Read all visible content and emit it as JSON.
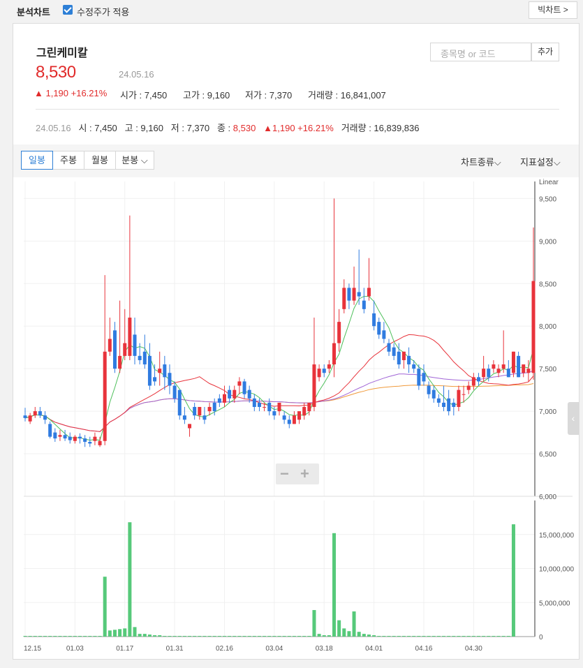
{
  "topbar": {
    "title": "분석차트",
    "adjusted_label": "수정주가 적용",
    "adjusted_checked": true,
    "big_chart": "빅차트 >"
  },
  "stock": {
    "name": "그린케미칼",
    "price": "8,530",
    "date": "24.05.16",
    "change": "▲ 1,190 +16.21%",
    "open_label": "시가 : 7,450",
    "high_label": "고가 : 9,160",
    "low_label": "저가 : 7,370",
    "volume_label": "거래량 : 16,841,007"
  },
  "search": {
    "placeholder": "종목명 or 코드",
    "add_label": "추가"
  },
  "detail": {
    "date": "24.05.16",
    "open": "시 : 7,450",
    "high": "고 : 9,160",
    "low": "저 : 7,370",
    "close_label": "종 :",
    "close": "8,530",
    "change": "▲1,190 +16.21%",
    "volume": "거래량 : 16,839,836"
  },
  "toolbar": {
    "periods": [
      "일봉",
      "주봉",
      "월봉",
      "분봉"
    ],
    "active_period": "일봉",
    "chart_type": "차트종류",
    "indicator": "지표설정"
  },
  "colors": {
    "up": "#e8333b",
    "down": "#2f7be0",
    "volume": "#56c97a",
    "ma5": "#4cbf5a",
    "ma20": "#e8333b",
    "ma60": "#a064d6",
    "ma120": "#f09a3b"
  },
  "chart_data": {
    "type": "candlestick",
    "scale": "Linear",
    "price_axis": {
      "ticks": [
        6000,
        6500,
        7000,
        7500,
        8000,
        8500,
        9000,
        9500
      ],
      "tick_labels": [
        "6,000",
        "6,500",
        "7,000",
        "7,500",
        "8,000",
        "8,500",
        "9,000",
        "9,500"
      ],
      "range": [
        6000,
        9700
      ]
    },
    "volume_axis": {
      "ticks": [
        0,
        5000000,
        10000000,
        15000000
      ],
      "tick_labels": [
        "0",
        "5,000,000",
        "10,000,000",
        "15,000,000"
      ],
      "range": [
        0,
        20000000
      ]
    },
    "x_labels": [
      {
        "label": "12.15",
        "index": 0
      },
      {
        "label": "01.03",
        "index": 10
      },
      {
        "label": "01.17",
        "index": 20
      },
      {
        "label": "01.31",
        "index": 30
      },
      {
        "label": "02.16",
        "index": 40
      },
      {
        "label": "03.04",
        "index": 50
      },
      {
        "label": "03.18",
        "index": 60
      },
      {
        "label": "04.01",
        "index": 70
      },
      {
        "label": "04.16",
        "index": 80
      },
      {
        "label": "04.30",
        "index": 90
      }
    ],
    "candles": [
      [
        6950,
        7040,
        6920,
        6880
      ],
      [
        6880,
        6980,
        6950,
        6850
      ],
      [
        6950,
        7050,
        7000,
        6920
      ],
      [
        7000,
        7050,
        6950,
        6920
      ],
      [
        6950,
        7000,
        6900,
        6850
      ],
      [
        6850,
        6880,
        6700,
        6680
      ],
      [
        6750,
        6800,
        6680,
        6640
      ],
      [
        6700,
        6780,
        6720,
        6650
      ],
      [
        6720,
        6780,
        6680,
        6650
      ],
      [
        6700,
        6750,
        6660,
        6620
      ],
      [
        6650,
        6720,
        6700,
        6620
      ],
      [
        6700,
        6740,
        6680,
        6620
      ],
      [
        6680,
        6720,
        6640,
        6580
      ],
      [
        6640,
        6700,
        6620,
        6580
      ],
      [
        6650,
        6750,
        6700,
        6600
      ],
      [
        6600,
        6700,
        6650,
        6580
      ],
      [
        6650,
        8600,
        7700,
        6600
      ],
      [
        7700,
        8100,
        7850,
        7650
      ],
      [
        7950,
        8050,
        7500,
        7450
      ],
      [
        7500,
        8300,
        7650,
        7450
      ],
      [
        7650,
        8200,
        7800,
        7600
      ],
      [
        7650,
        9300,
        8100,
        7600
      ],
      [
        7900,
        8100,
        7650,
        7550
      ],
      [
        7650,
        7800,
        7600,
        7550
      ],
      [
        7700,
        7900,
        7550,
        7500
      ],
      [
        7650,
        7800,
        7300,
        7250
      ],
      [
        7400,
        7550,
        7350,
        7300
      ],
      [
        7450,
        7700,
        7500,
        7300
      ],
      [
        7550,
        7650,
        7400,
        7250
      ],
      [
        7450,
        7550,
        7300,
        7200
      ],
      [
        7300,
        7350,
        7150,
        7100
      ],
      [
        7250,
        7250,
        6950,
        6900
      ],
      [
        6950,
        7050,
        6900,
        6850
      ],
      [
        6800,
        6850,
        6850,
        6700
      ],
      [
        7050,
        7100,
        6950,
        6900
      ],
      [
        6950,
        7050,
        7050,
        6900
      ],
      [
        6950,
        7050,
        6900,
        6850
      ],
      [
        7000,
        7100,
        7050,
        6950
      ],
      [
        7100,
        7150,
        7000,
        6950
      ],
      [
        7150,
        7200,
        7100,
        7050
      ],
      [
        7100,
        7300,
        7200,
        7050
      ],
      [
        7250,
        7300,
        7150,
        7100
      ],
      [
        7150,
        7300,
        7250,
        7100
      ],
      [
        7300,
        7400,
        7350,
        7200
      ],
      [
        7350,
        7380,
        7200,
        7150
      ],
      [
        7250,
        7300,
        7150,
        7100
      ],
      [
        7150,
        7200,
        7050,
        7000
      ],
      [
        7100,
        7150,
        7050,
        7000
      ],
      [
        7050,
        7100,
        7050,
        7000
      ],
      [
        7100,
        7150,
        7000,
        6950
      ],
      [
        7000,
        7050,
        6950,
        6900
      ],
      [
        7000,
        7100,
        7100,
        6950
      ],
      [
        6950,
        7000,
        6900,
        6850
      ],
      [
        6900,
        6950,
        6850,
        6800
      ],
      [
        6850,
        7000,
        6950,
        6850
      ],
      [
        6900,
        6950,
        7000,
        6850
      ],
      [
        6950,
        7100,
        7050,
        6900
      ],
      [
        7000,
        7050,
        7100,
        6950
      ],
      [
        7050,
        8100,
        7550,
        7000
      ],
      [
        7400,
        7550,
        7500,
        7350
      ],
      [
        7500,
        7550,
        7450,
        7400
      ],
      [
        7500,
        7600,
        7550,
        7450
      ],
      [
        7550,
        9500,
        7800,
        7400
      ],
      [
        7800,
        8200,
        8050,
        7700
      ],
      [
        8200,
        8550,
        8450,
        8150
      ],
      [
        8450,
        8500,
        8300,
        8200
      ],
      [
        8300,
        8700,
        8450,
        8250
      ],
      [
        8400,
        8900,
        8350,
        8250
      ],
      [
        8300,
        8450,
        8200,
        8150
      ],
      [
        8350,
        8800,
        8450,
        8300
      ],
      [
        8150,
        8300,
        8000,
        7950
      ],
      [
        8050,
        8100,
        7900,
        7850
      ],
      [
        7950,
        8050,
        7850,
        7800
      ],
      [
        7800,
        7850,
        7700,
        7650
      ],
      [
        7750,
        7800,
        7650,
        7600
      ],
      [
        7700,
        7800,
        7550,
        7500
      ],
      [
        7600,
        7700,
        7700,
        7500
      ],
      [
        7650,
        7750,
        7550,
        7450
      ],
      [
        7550,
        7600,
        7500,
        7450
      ],
      [
        7500,
        7550,
        7300,
        7250
      ],
      [
        7450,
        7550,
        7350,
        7300
      ],
      [
        7300,
        7350,
        7200,
        7150
      ],
      [
        7250,
        7300,
        7150,
        7100
      ],
      [
        7150,
        7200,
        7100,
        7050
      ],
      [
        7100,
        7300,
        7050,
        7000
      ],
      [
        7150,
        7250,
        7000,
        6950
      ],
      [
        7100,
        7150,
        7050,
        6950
      ],
      [
        7050,
        7300,
        7250,
        7000
      ],
      [
        7200,
        7300,
        7200,
        7100
      ],
      [
        7250,
        7350,
        7300,
        7200
      ],
      [
        7300,
        7450,
        7400,
        7250
      ],
      [
        7400,
        7450,
        7350,
        7300
      ],
      [
        7400,
        7650,
        7500,
        7350
      ],
      [
        7500,
        7550,
        7400,
        7350
      ],
      [
        7500,
        7600,
        7550,
        7450
      ],
      [
        7450,
        7550,
        7500,
        7400
      ],
      [
        7500,
        7950,
        7550,
        7450
      ],
      [
        7500,
        7600,
        7400,
        7400
      ],
      [
        7450,
        7700,
        7700,
        7400
      ],
      [
        7650,
        7700,
        7400,
        7400
      ],
      [
        7450,
        7500,
        7550,
        7400
      ],
      [
        7450,
        7600,
        7500,
        7350
      ],
      [
        7450,
        9160,
        8530,
        7370
      ]
    ],
    "volumes": [
      0.1,
      0.1,
      0.1,
      0.1,
      0.1,
      0.1,
      0.1,
      0.1,
      0.1,
      0.1,
      0.1,
      0.1,
      0.1,
      0.1,
      0.1,
      0.1,
      8.8,
      0.9,
      1.0,
      1.1,
      1.2,
      16.8,
      1.4,
      0.4,
      0.4,
      0.3,
      0.2,
      0.2,
      0.1,
      0.1,
      0.1,
      0.1,
      0.1,
      0.1,
      0.1,
      0.1,
      0.1,
      0.1,
      0.1,
      0.1,
      0.1,
      0.1,
      0.1,
      0.1,
      0.1,
      0.1,
      0.1,
      0.1,
      0.1,
      0.1,
      0.1,
      0.1,
      0.1,
      0.1,
      0.1,
      0.1,
      0.1,
      0.1,
      3.9,
      0.4,
      0.2,
      0.2,
      15.2,
      2.4,
      1.2,
      0.8,
      3.7,
      0.7,
      0.4,
      0.3,
      0.2,
      0.1,
      0.1,
      0.1,
      0.1,
      0.1,
      0.1,
      0.1,
      0.1,
      0.1,
      0.1,
      0.1,
      0.1,
      0.1,
      0.1,
      0.1,
      0.1,
      0.1,
      0.1,
      0.1,
      0.1,
      0.1,
      0.1,
      0.1,
      0.1,
      0.1,
      0.1,
      0.1,
      16.5
    ],
    "volume_unit": 1000000
  }
}
